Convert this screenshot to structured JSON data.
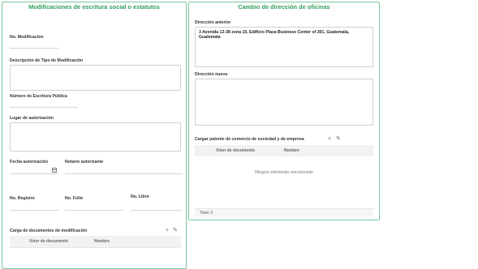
{
  "left_panel": {
    "title": "Modificaciones de escritura social o estatutos",
    "no_modificacion_label": "No. Modificación",
    "descripcion_label": "Descripción de Tipo de Modificación",
    "no_escritura_label": "Número de Escritura Pública",
    "lugar_label": "Lugar de autorización",
    "fecha_label": "Fecha autorización",
    "notario_label": "Notario autorizante",
    "no_registro_label": "No. Registro",
    "no_folio_label": "No. Folio",
    "no_libro_label": "No. Libro",
    "carga_docs_label": "Carga de documentos de modificación",
    "table": {
      "col_visor": "Visor de documento",
      "col_nombre": "Nombre"
    }
  },
  "right_panel": {
    "title": "Cambio de dirección de oficinas",
    "direccion_anterior_label": "Dirección anterior",
    "direccion_anterior_value": "3 Avenida 12-38 zona 10, Edificio Plaza Business Center of 301, Guatemala, Guatemala",
    "direccion_nueva_label": "Dirección nueva",
    "direccion_nueva_value": "",
    "patente_label": "Cargar patente de comercio de sociedad y de empresa",
    "table": {
      "col_visor": "Visor de documento",
      "col_nombre": "Nombre",
      "empty_message": "Ningún elemento encontrado",
      "total": "Total: 0"
    }
  },
  "icons": {
    "add": "+",
    "edit": "✎"
  },
  "colors": {
    "accent": "#2f9e5a",
    "panel_border": "#7ac79a"
  }
}
